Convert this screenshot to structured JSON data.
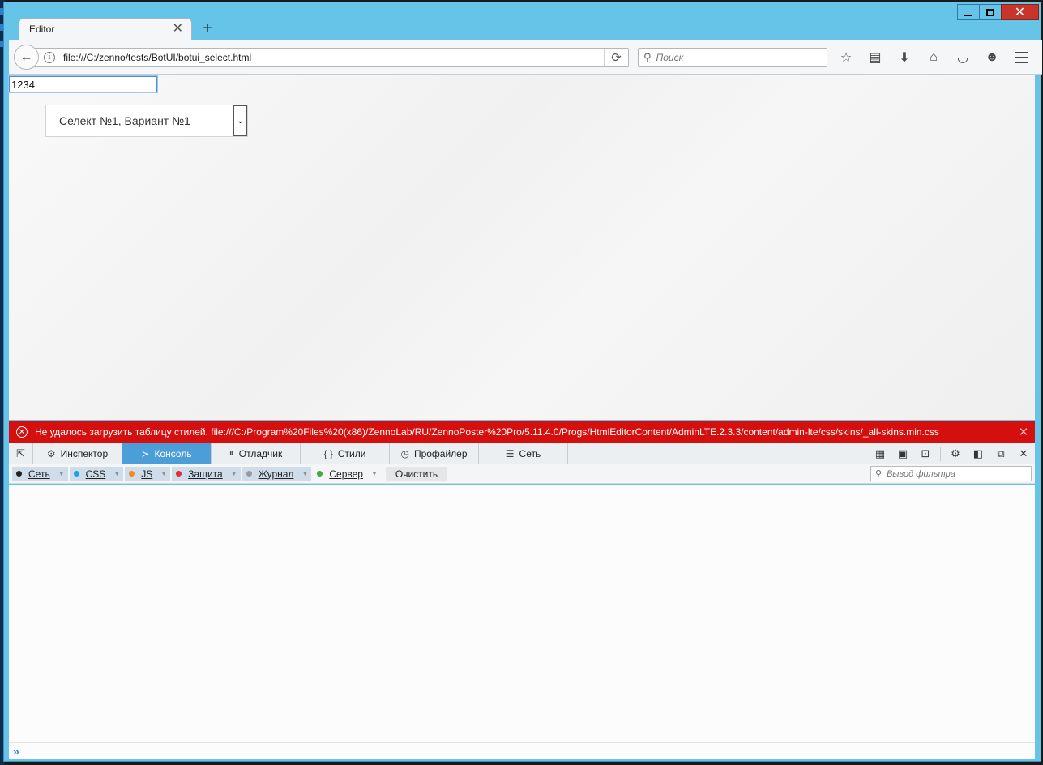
{
  "window": {
    "minimize_glyph": "—",
    "maximize_glyph": "□",
    "close_glyph": "✕"
  },
  "tab": {
    "title": "Editor",
    "close_glyph": "✕",
    "new_tab_glyph": "+"
  },
  "navbar": {
    "back_glyph": "←",
    "info_glyph": "i",
    "url": "file:///C:/zenno/tests/BotUI/botui_select.html",
    "reload_glyph": "⟳",
    "search_placeholder": "Поиск",
    "search_icon": "⚲",
    "icons": [
      {
        "name": "bookmark-star-icon",
        "glyph": "☆"
      },
      {
        "name": "bookmarks-list-icon",
        "glyph": "▤"
      },
      {
        "name": "downloads-icon",
        "glyph": "⬇"
      },
      {
        "name": "home-icon",
        "glyph": "⌂"
      },
      {
        "name": "pocket-icon",
        "glyph": "◡"
      },
      {
        "name": "chat-icon",
        "glyph": "☻"
      }
    ]
  },
  "page": {
    "input_value": "1234",
    "select_value": "Селект №1, Вариант №1",
    "select_arrow_glyph": "⌄"
  },
  "error_bar": {
    "icon_glyph": "✕",
    "message": "Не удалось загрузить таблицу стилей. file:///C:/Program%20Files%20(x86)/ZennoLab/RU/ZennoPoster%20Pro/5.11.4.0/Progs/HtmlEditorContent/AdminLTE.2.3.3/content/admin-lte/css/skins/_all-skins.min.css",
    "close_glyph": "✕",
    "color": "#d50e0e"
  },
  "devtools": {
    "picker_glyph": "⇱",
    "tabs": [
      {
        "label": "Инспектор",
        "icon": "⚙"
      },
      {
        "label": "Консоль",
        "icon": "≻"
      },
      {
        "label": "Отладчик",
        "icon": "⏸"
      },
      {
        "label": "Стили",
        "icon": "{ }"
      },
      {
        "label": "Профайлер",
        "icon": "◷"
      },
      {
        "label": "Сеть",
        "icon": "☰"
      }
    ],
    "active_tab": "Консоль",
    "right_icons": [
      {
        "name": "split-view-icon",
        "glyph": "▦"
      },
      {
        "name": "screenshot-icon",
        "glyph": "▣"
      },
      {
        "name": "responsive-icon",
        "glyph": "⊡"
      },
      {
        "name": "settings-icon",
        "glyph": "⚙"
      },
      {
        "name": "dock-side-icon",
        "glyph": "◧"
      },
      {
        "name": "undock-icon",
        "glyph": "⧉"
      },
      {
        "name": "close-devtools-icon",
        "glyph": "✕"
      }
    ],
    "filters": [
      {
        "label": "Сеть",
        "color": "#222222",
        "active": true
      },
      {
        "label": "CSS",
        "color": "#1aa3e8",
        "active": true
      },
      {
        "label": "JS",
        "color": "#f08c1c",
        "active": true
      },
      {
        "label": "Защита",
        "color": "#e0303a",
        "active": true
      },
      {
        "label": "Журнал",
        "color": "#9a9a9a",
        "active": true
      },
      {
        "label": "Сервер",
        "color": "#4aa54a",
        "active": false
      }
    ],
    "clear_label": "Очистить",
    "filter_placeholder": "Вывод фильтра",
    "prompt_glyph": "»"
  }
}
